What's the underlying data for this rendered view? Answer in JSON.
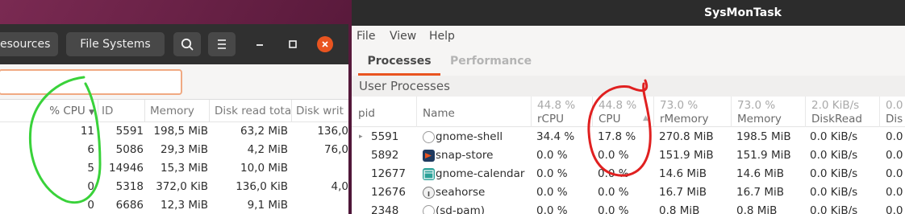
{
  "left_window": {
    "tabs": [
      {
        "label": "esources"
      },
      {
        "label": "File Systems"
      }
    ],
    "icons": {
      "search": "search-icon",
      "menu": "hamburger-menu-icon",
      "minimize": "minimize-icon",
      "maximize": "maximize-icon",
      "close": "close-icon"
    },
    "search": {
      "value": "",
      "placeholder": ""
    },
    "columns": {
      "cpu": "% CPU",
      "id": "ID",
      "memory": "Memory",
      "disk_read": "Disk read tota",
      "disk_write": "Disk writ"
    },
    "rows": [
      {
        "cpu": "11",
        "id": "5591",
        "memory": "198,5 MiB",
        "disk_read": "63,2 MiB",
        "disk_write": "136,0"
      },
      {
        "cpu": "6",
        "id": "5086",
        "memory": "29,3 MiB",
        "disk_read": "4,2 MiB",
        "disk_write": "76,0"
      },
      {
        "cpu": "5",
        "id": "14946",
        "memory": "15,3 MiB",
        "disk_read": "10,0 MiB",
        "disk_write": ""
      },
      {
        "cpu": "0",
        "id": "5318",
        "memory": "372,0 KiB",
        "disk_read": "136,0 KiB",
        "disk_write": "4,0"
      },
      {
        "cpu": "0",
        "id": "6686",
        "memory": "12,3 MiB",
        "disk_read": "9,1 MiB",
        "disk_write": ""
      }
    ]
  },
  "right_window": {
    "title": "SysMonTask",
    "menu": {
      "file": "File",
      "view": "View",
      "help": "Help"
    },
    "tabs": {
      "processes": "Processes",
      "performance": "Performance"
    },
    "section_title": "User Processes",
    "columns": {
      "pid": "pid",
      "name": "Name",
      "rcpu_stat": "44.8 %",
      "rcpu": "rCPU",
      "cpu_stat": "44.8 %",
      "cpu": "CPU",
      "rmem_stat": "73.0 %",
      "rmem": "rMemory",
      "mem_stat": "73.0 %",
      "mem": "Memory",
      "dread_stat": "2.0 KiB/s",
      "dread": "DiskRead",
      "dw_stat": "0.0",
      "dw": "Dis"
    },
    "rows": [
      {
        "expander": "▸",
        "pid": "5591",
        "icon": "gnome-shell-icon",
        "icon_color": "#ffffff",
        "name": "gnome-shell",
        "rcpu": "34.4 %",
        "cpu": "17.8 %",
        "rmem": "270.8 MiB",
        "mem": "198.5 MiB",
        "dread": "0.0 KiB/s",
        "dw": "0.0"
      },
      {
        "expander": "",
        "pid": "5892",
        "icon": "snap-store-icon",
        "icon_color": "#1f3a5f",
        "name": "snap-store",
        "rcpu": "0.0 %",
        "cpu": "0.0 %",
        "rmem": "151.9 MiB",
        "mem": "151.9 MiB",
        "dread": "0.0 KiB/s",
        "dw": "0.0"
      },
      {
        "expander": "",
        "pid": "12677",
        "icon": "calendar-icon",
        "icon_color": "#2aa198",
        "name": "gnome-calendar",
        "rcpu": "0.0 %",
        "cpu": "0.0 %",
        "rmem": "14.6 MiB",
        "mem": "14.6 MiB",
        "dread": "0.0 KiB/s",
        "dw": "0.0"
      },
      {
        "expander": "",
        "pid": "12676",
        "icon": "seahorse-icon",
        "icon_color": "#f2f2f2",
        "name": "seahorse",
        "rcpu": "0.0 %",
        "cpu": "0.0 %",
        "rmem": "16.7 MiB",
        "mem": "16.7 MiB",
        "dread": "0.0 KiB/s",
        "dw": "0.0"
      },
      {
        "expander": "",
        "pid": "2348",
        "icon": "process-icon",
        "icon_color": "#ffffff",
        "name": "(sd-pam)",
        "rcpu": "0.0 %",
        "cpu": "0.0 %",
        "rmem": "0.8 MiB",
        "mem": "0.8 MiB",
        "dread": "0.0 KiB/s",
        "dw": "0.0"
      }
    ]
  },
  "annotations": {
    "green_circle_color": "#39d23a",
    "red_circle_color": "#e02020"
  }
}
